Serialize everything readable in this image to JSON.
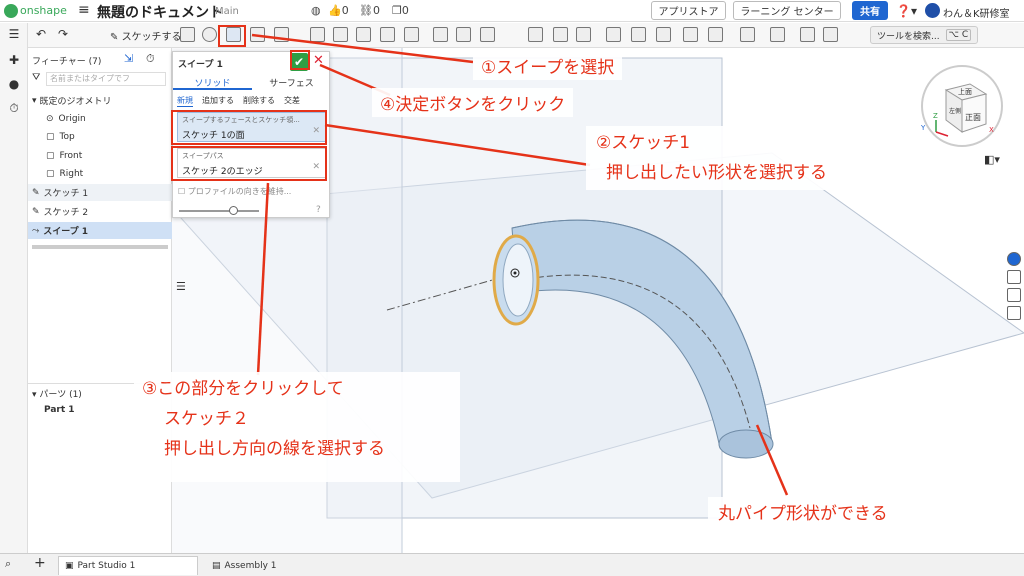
{
  "topbar": {
    "logo": "onshape",
    "doc_title": "無題のドキュメント",
    "branch": "Main",
    "likes": "0",
    "links": "0",
    "copies": "0",
    "appstore": "アプリストア",
    "learning": "ラーニング センター",
    "share": "共有",
    "user": "わん＆K研修室"
  },
  "toolbar": {
    "sketch": "スケッチする",
    "search_tools": "ツールを検索...",
    "search_kbd": "⌥ C"
  },
  "feature_panel": {
    "title": "フィーチャー (7)",
    "filter_placeholder": "名前またはタイプでフ",
    "default_geometry": "既定のジオメトリ",
    "items": [
      "Origin",
      "Top",
      "Front",
      "Right"
    ],
    "features": [
      "スケッチ 1",
      "スケッチ 2",
      "スイープ 1"
    ],
    "parts_header": "パーツ (1)",
    "part": "Part 1"
  },
  "dialog": {
    "title": "スイープ 1",
    "tab_solid": "ソリッド",
    "tab_surface": "サーフェス",
    "ops": [
      "新規",
      "追加する",
      "削除する",
      "交差"
    ],
    "field1_label": "スイープするフェースとスケッチ領...",
    "field1_value": "スケッチ 1の面",
    "field2_label": "スイープパス",
    "field2_value": "スケッチ 2のエッジ",
    "profile_option": "プロファイルの向きを維持..."
  },
  "viewcube": {
    "top": "上面",
    "front": "正面",
    "left": "左側",
    "z": "Z",
    "x": "X",
    "y": "Y"
  },
  "bottom_tabs": [
    "Part Studio 1",
    "Assembly 1"
  ],
  "annotations": {
    "step1": "①スイープを選択",
    "step4": "④決定ボタンをクリック",
    "step2_line1": "②スケッチ1",
    "step2_line2": "押し出したい形状を選択する",
    "step3_line1": "③この部分をクリックして",
    "step3_line2": "スケッチ２",
    "step3_line3": "押し出し方向の線を選択する",
    "result": "丸パイプ形状ができる"
  },
  "colors": {
    "annotation_red": "#e53219",
    "accent_blue": "#1f66d1",
    "ok_green": "#2f9e44"
  }
}
